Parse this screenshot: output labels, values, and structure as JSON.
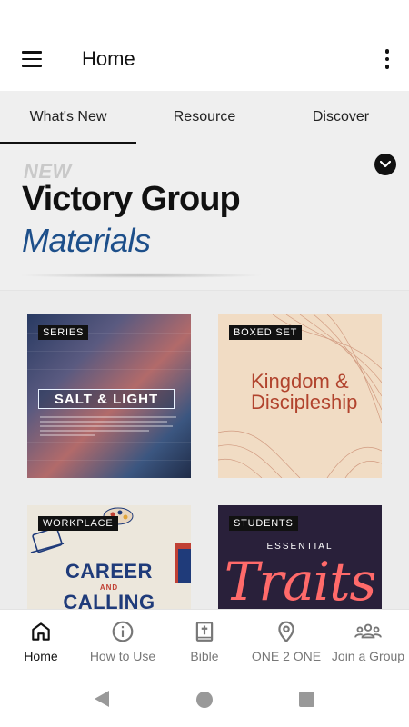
{
  "app": {
    "title": "Home"
  },
  "tabs": [
    {
      "label": "What's New",
      "active": true
    },
    {
      "label": "Resource",
      "active": false
    },
    {
      "label": "Discover",
      "active": false
    }
  ],
  "banner": {
    "new": "NEW",
    "title": "Victory Group",
    "subtitle": "Materials"
  },
  "cards": [
    {
      "tag": "SERIES",
      "title": "SALT & LIGHT"
    },
    {
      "tag": "BOXED SET",
      "title_line1": "Kingdom &",
      "title_line2": "Discipleship"
    },
    {
      "tag": "WORKPLACE",
      "title_line1": "CAREER",
      "title_and": "AND",
      "title_line2": "CALLING"
    },
    {
      "tag": "STUDENTS",
      "kicker": "ESSENTIAL",
      "title": "Traits"
    }
  ],
  "bottom_nav": [
    {
      "label": "Home",
      "icon": "home-icon",
      "active": true
    },
    {
      "label": "How to Use",
      "icon": "info-icon",
      "active": false
    },
    {
      "label": "Bible",
      "icon": "bible-icon",
      "active": false
    },
    {
      "label": "ONE 2 ONE",
      "icon": "location-pin-icon",
      "active": false
    },
    {
      "label": "Join a Group",
      "icon": "group-icon",
      "active": false
    }
  ],
  "colors": {
    "accent": "#111111",
    "banner_subtitle": "#1d4f8a",
    "kingdom_text": "#b1432d",
    "career_text": "#1f3b7a"
  }
}
